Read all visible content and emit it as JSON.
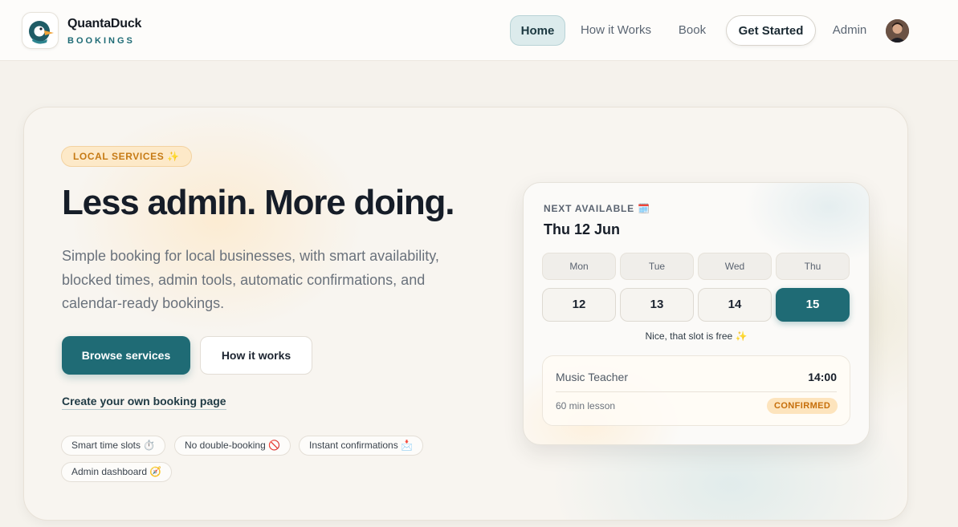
{
  "brand": {
    "name": "QuantaDuck",
    "subtitle": "BOOKINGS"
  },
  "nav": {
    "home": "Home",
    "how_it_works": "How it Works",
    "book": "Book",
    "get_started": "Get Started",
    "admin": "Admin"
  },
  "hero": {
    "badge": "LOCAL SERVICES ✨",
    "headline": "Less admin. More doing.",
    "description": "Simple booking for local businesses, with smart availability, blocked times, admin tools, automatic confirmations, and calendar-ready bookings.",
    "primary_button": "Browse services",
    "secondary_button": "How it works",
    "create_link": "Create your own booking page",
    "features": [
      "Smart time slots ⏱️",
      "No double-booking 🚫",
      "Instant confirmations 📩",
      "Admin dashboard 🧭"
    ]
  },
  "booking_card": {
    "label": "NEXT AVAILABLE 🗓️",
    "date": "Thu 12 Jun",
    "days": [
      "Mon",
      "Tue",
      "Wed",
      "Thu"
    ],
    "dates": [
      "12",
      "13",
      "14",
      "15"
    ],
    "selected_date": "15",
    "slot_message": "Nice, that slot is free ✨",
    "slot": {
      "service": "Music Teacher",
      "time": "14:00",
      "duration": "60 min lesson",
      "status": "CONFIRMED"
    }
  },
  "colors": {
    "accent": "#1f6b75",
    "badge_text": "#c67a14",
    "status_confirmed": "#c66e0a"
  }
}
